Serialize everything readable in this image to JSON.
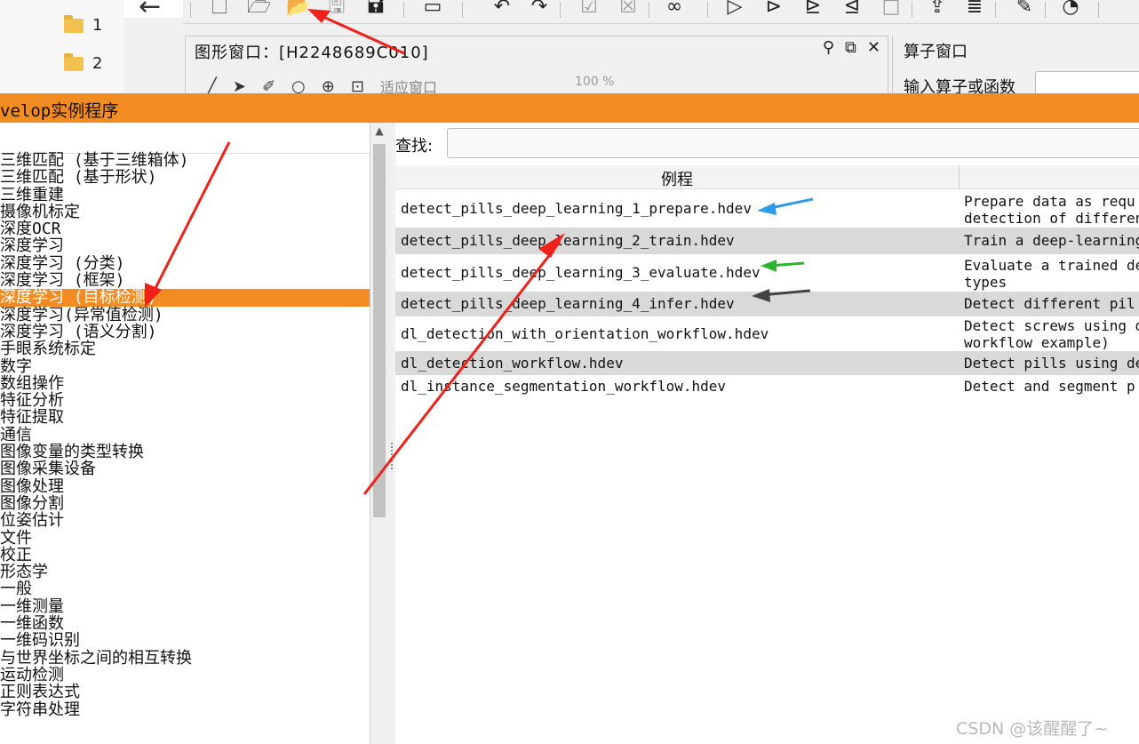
{
  "explorer": {
    "folders": [
      {
        "label": "1",
        "icon": "folder-icon"
      },
      {
        "label": "2",
        "icon": "folder-icon"
      }
    ]
  },
  "toolbar": {
    "icons": [
      "new-file-icon",
      "open-file-icon",
      "open-example-icon",
      "save-icon",
      "save-all-icon",
      "video-icon",
      "undo-icon",
      "redo-icon",
      "check-icon",
      "cancel-icon",
      "binoculars-icon",
      "run-icon",
      "step-icon",
      "step-into-icon",
      "step-out-icon",
      "stop-icon",
      "export-icon",
      "report-icon",
      "assistant-icon",
      "speedometer-icon"
    ]
  },
  "graphics_window": {
    "title": "图形窗口：[H2248689C010]",
    "tool_label": "适应窗口",
    "zoom": "100 %"
  },
  "operator_window": {
    "title": "算子窗口",
    "input_label": "输入算子或函数"
  },
  "dialog": {
    "title": "velop实例程序",
    "search_label": "查找:",
    "search_value": "",
    "column_example": "例程",
    "column_description": "",
    "categories": [
      {
        "label": "三维匹配 (基于三维箱体)"
      },
      {
        "label": "三维匹配 (基于形状)"
      },
      {
        "label": "三维重建"
      },
      {
        "label": "摄像机标定"
      },
      {
        "label": "深度OCR"
      },
      {
        "label": "深度学习"
      },
      {
        "label": "深度学习 (分类)"
      },
      {
        "label": "深度学习 (框架)"
      },
      {
        "label": "深度学习 (目标检测)"
      },
      {
        "label": "深度学习(异常值检测)"
      },
      {
        "label": "深度学习 (语义分割)"
      },
      {
        "label": "手眼系统标定"
      },
      {
        "label": "数字"
      },
      {
        "label": "数组操作"
      },
      {
        "label": "特征分析"
      },
      {
        "label": "特征提取"
      },
      {
        "label": "通信"
      },
      {
        "label": "图像变量的类型转换"
      },
      {
        "label": "图像采集设备"
      },
      {
        "label": "图像处理"
      },
      {
        "label": "图像分割"
      },
      {
        "label": "位姿估计"
      },
      {
        "label": "文件"
      },
      {
        "label": "校正"
      },
      {
        "label": "形态学"
      },
      {
        "label": "一般"
      },
      {
        "label": "一维测量"
      },
      {
        "label": "一维函数"
      },
      {
        "label": "一维码识别"
      },
      {
        "label": "与世界坐标之间的相互转换"
      },
      {
        "label": "运动检测"
      },
      {
        "label": "正则表达式"
      },
      {
        "label": "字符串处理"
      }
    ],
    "selected_category": "深度学习 (目标检测)",
    "examples": [
      {
        "file": "detect_pills_deep_learning_1_prepare.hdev",
        "desc": "Prepare data as requ\ndetection of differen"
      },
      {
        "file": "detect_pills_deep_learning_2_train.hdev",
        "desc": "Train a deep-learning"
      },
      {
        "file": "detect_pills_deep_learning_3_evaluate.hdev",
        "desc": "Evaluate a trained de\ntypes"
      },
      {
        "file": "detect_pills_deep_learning_4_infer.hdev",
        "desc": "Detect different pil"
      },
      {
        "file": "dl_detection_with_orientation_workflow.hdev",
        "desc": "Detect screws using d\nworkflow example)"
      },
      {
        "file": "dl_detection_workflow.hdev",
        "desc": "Detect pills using de"
      },
      {
        "file": "dl_instance_segmentation_workflow.hdev",
        "desc": "Detect and segment p"
      }
    ]
  },
  "watermark": "CSDN @该醒醒了~",
  "annotation_colors": {
    "red": "#f0201a",
    "blue": "#2f9ae8",
    "green": "#2db52d",
    "dark": "#444444",
    "accent": "#f28c22"
  }
}
